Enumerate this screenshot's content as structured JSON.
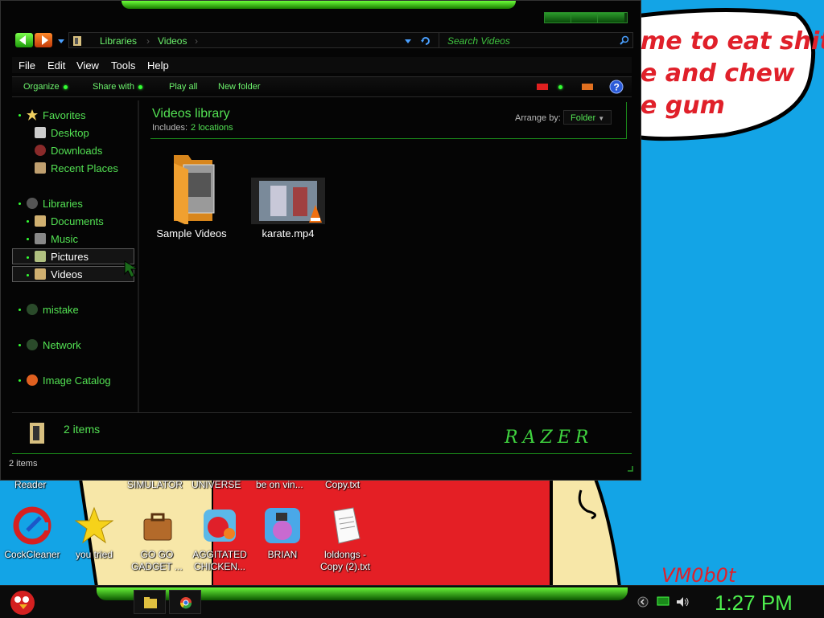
{
  "desktop": {
    "speech_lines": [
      "me to eat shit",
      "e and chew",
      "e gum"
    ],
    "watermark": "VM0b0t",
    "top_labels": [
      "Reader",
      "SIMULATOR",
      "UNIVERSE",
      "be on vin...",
      "Copy.txt"
    ],
    "icons": [
      {
        "label": "CockCleaner",
        "icon": "ccleaner-icon"
      },
      {
        "label": "you tried",
        "icon": "gold-star-icon"
      },
      {
        "label": "GO GO GADGET ...",
        "icon": "briefcase-icon"
      },
      {
        "label": "AGGITATED CHICKEN...",
        "icon": "angry-birds-icon"
      },
      {
        "label": "BRIAN",
        "icon": "angry-birds-rio-icon"
      },
      {
        "label": "loldongs - Copy (2).txt",
        "icon": "text-file-icon"
      }
    ]
  },
  "window": {
    "breadcrumb": [
      "Libraries",
      "Videos"
    ],
    "search_placeholder": "Search Videos",
    "menu": [
      "File",
      "Edit",
      "View",
      "Tools",
      "Help"
    ],
    "commands": [
      "Organize",
      "Share with",
      "Play all",
      "New folder"
    ],
    "nav": {
      "favorites": {
        "label": "Favorites",
        "items": [
          "Desktop",
          "Downloads",
          "Recent Places"
        ]
      },
      "libraries": {
        "label": "Libraries",
        "items": [
          "Documents",
          "Music",
          "Pictures",
          "Videos"
        ]
      },
      "others": [
        "mistake",
        "Network",
        "Image Catalog"
      ]
    },
    "library": {
      "title": "Videos library",
      "includes_label": "Includes:",
      "includes_value": "2 locations",
      "arrange_label": "Arrange by:",
      "arrange_value": "Folder"
    },
    "files": [
      {
        "name": "Sample Videos",
        "type": "folder"
      },
      {
        "name": "karate.mp4",
        "type": "video"
      }
    ],
    "details_count": "2 items",
    "brand": "RAZER",
    "status": "2 items"
  },
  "taskbar": {
    "clock": "1:27 PM"
  },
  "colors": {
    "accent": "#53e253",
    "desktop_blue": "#13a4e6",
    "wallpaper_red": "#e0202a",
    "wallpaper_cream": "#f7e7a8"
  }
}
